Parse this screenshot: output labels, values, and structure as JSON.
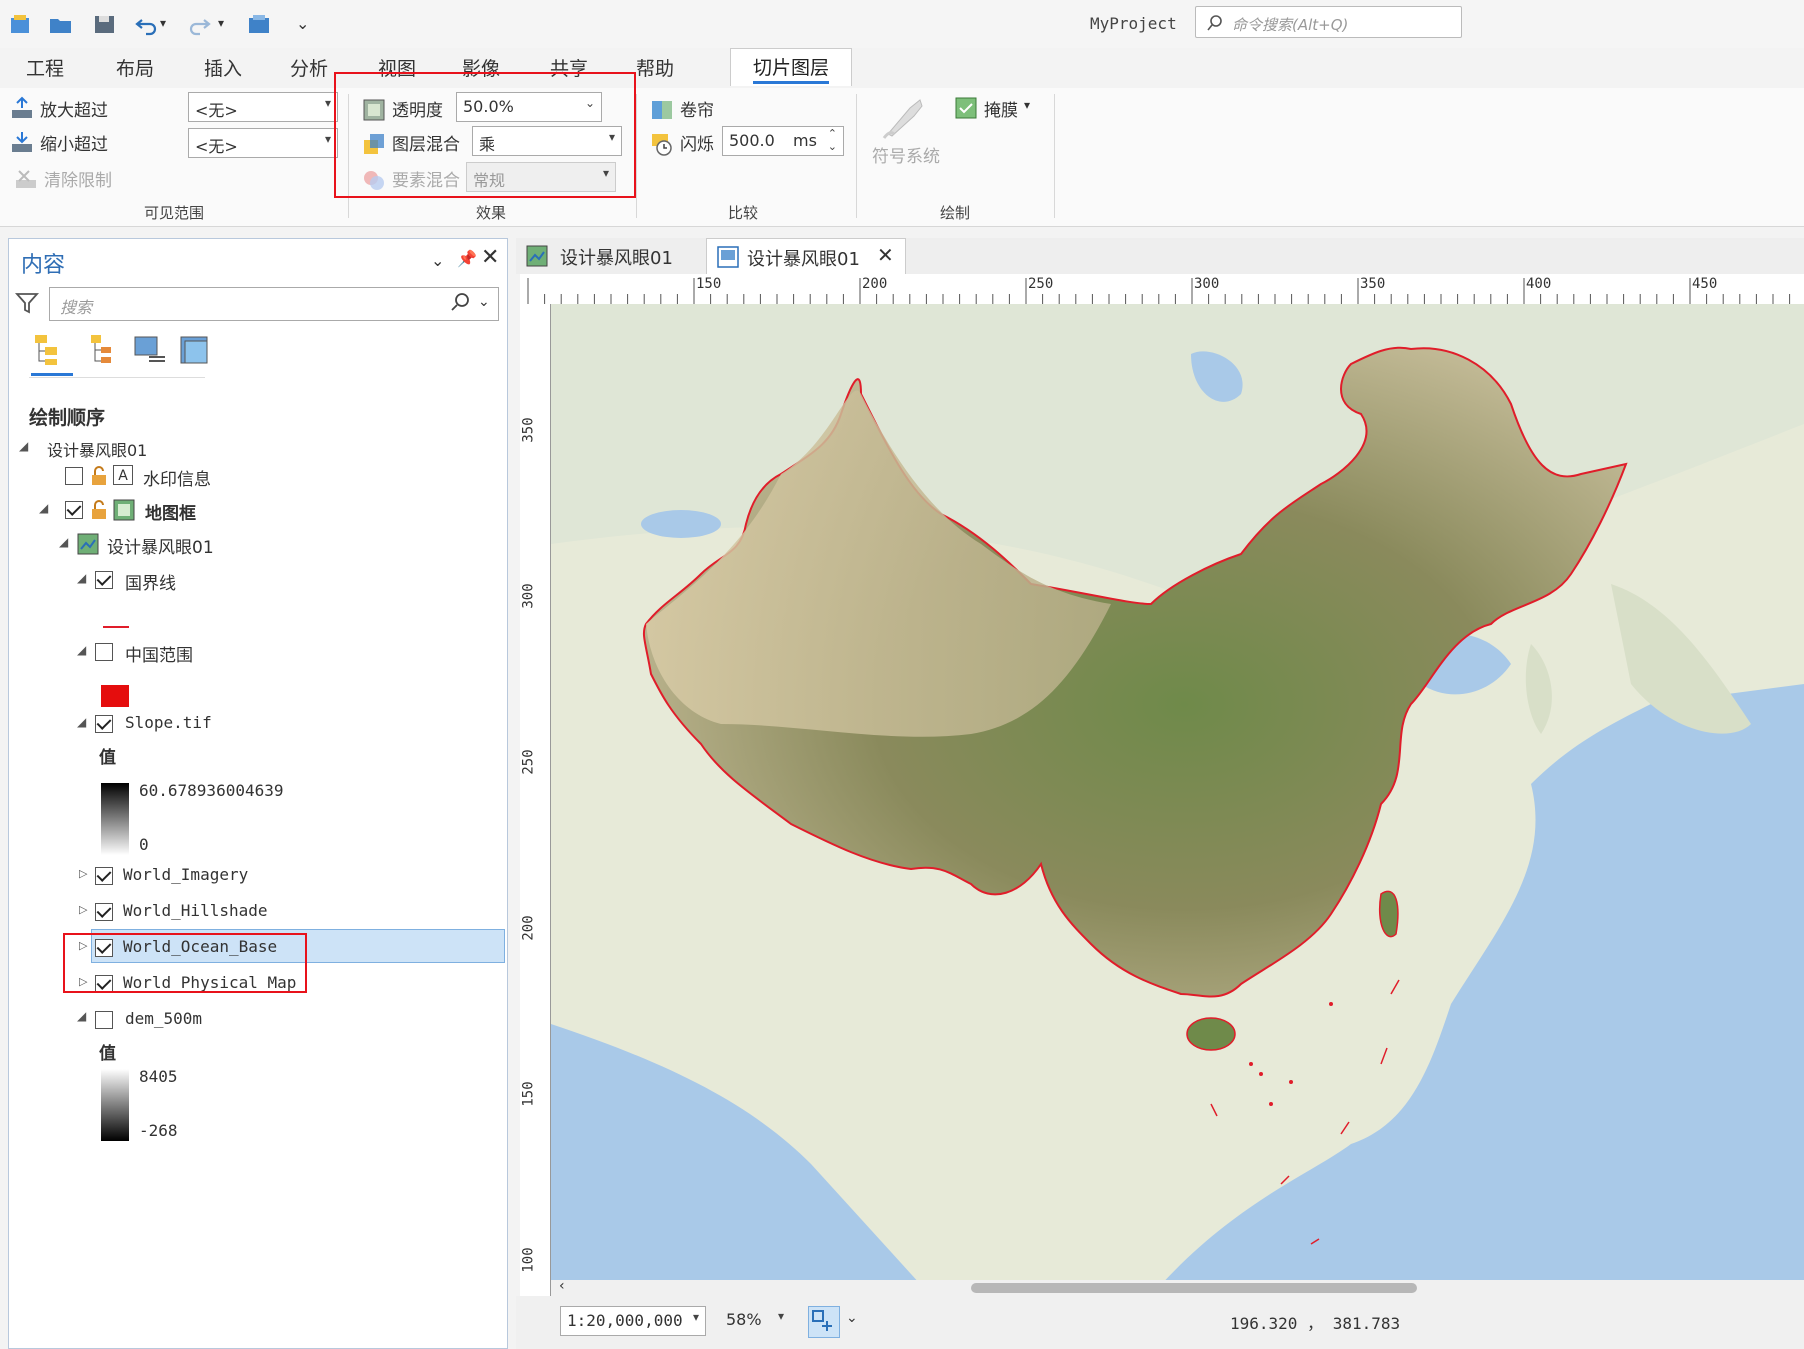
{
  "app": {
    "project": "MyProject",
    "command_search_placeholder": "命令搜索(Alt+Q)"
  },
  "ribbon_tabs": [
    "工程",
    "布局",
    "插入",
    "分析",
    "视图",
    "影像",
    "共享",
    "帮助",
    "切片图层"
  ],
  "active_tab": "切片图层",
  "ribbon": {
    "visible_range": {
      "zoom_in_beyond": "放大超过",
      "zoom_out_beyond": "缩小超过",
      "clear_limits": "清除限制",
      "zoom_in_value": "<无>",
      "zoom_out_value": "<无>",
      "group": "可见范围"
    },
    "effects": {
      "transparency_label": "透明度",
      "transparency_value": "50.0%",
      "layer_blend_label": "图层混合",
      "layer_blend_value": "乘",
      "feature_blend_label": "要素混合",
      "feature_blend_value": "常规",
      "group": "效果"
    },
    "compare": {
      "swipe": "卷帘",
      "flicker": "闪烁",
      "flicker_value": "500.0",
      "flicker_unit": "ms",
      "group": "比较"
    },
    "drawing": {
      "symbology": "符号系统",
      "mask": "掩膜",
      "group": "绘制"
    }
  },
  "contents": {
    "title": "内容",
    "search_placeholder": "搜索",
    "section": "绘制顺序",
    "map_name": "设计暴风眼01",
    "watermark": "水印信息",
    "map_frame": "地图框",
    "map_layer": "设计暴风眼01",
    "layers": {
      "boundary": "国界线",
      "china_extent": "中国范围",
      "slope": "Slope.tif",
      "slope_value_label": "值",
      "slope_max": "60.678936004639",
      "slope_min": "0",
      "imagery": "World_Imagery",
      "hillshade": "World_Hillshade",
      "ocean": "World_Ocean_Base",
      "physical": "World_Physical_Map",
      "dem": "dem_500m",
      "dem_value_label": "值",
      "dem_max": "8405",
      "dem_min": "-268"
    }
  },
  "map_tabs": [
    "设计暴风眼01",
    "设计暴风眼01"
  ],
  "ruler": {
    "top_ticks": [
      "150",
      "200",
      "250",
      "300",
      "350",
      "400",
      "450"
    ],
    "left_ticks": [
      "350",
      "300",
      "250",
      "200",
      "150",
      "100"
    ]
  },
  "status": {
    "scale": "1:20,000,000",
    "zoom": "58%",
    "coords": "196.320 ， 381.783"
  },
  "colors": {
    "accent": "#2a78d6",
    "highlight": "#e8121b",
    "boundary": "#e01d2a",
    "selected_row": "#cde3f7"
  }
}
